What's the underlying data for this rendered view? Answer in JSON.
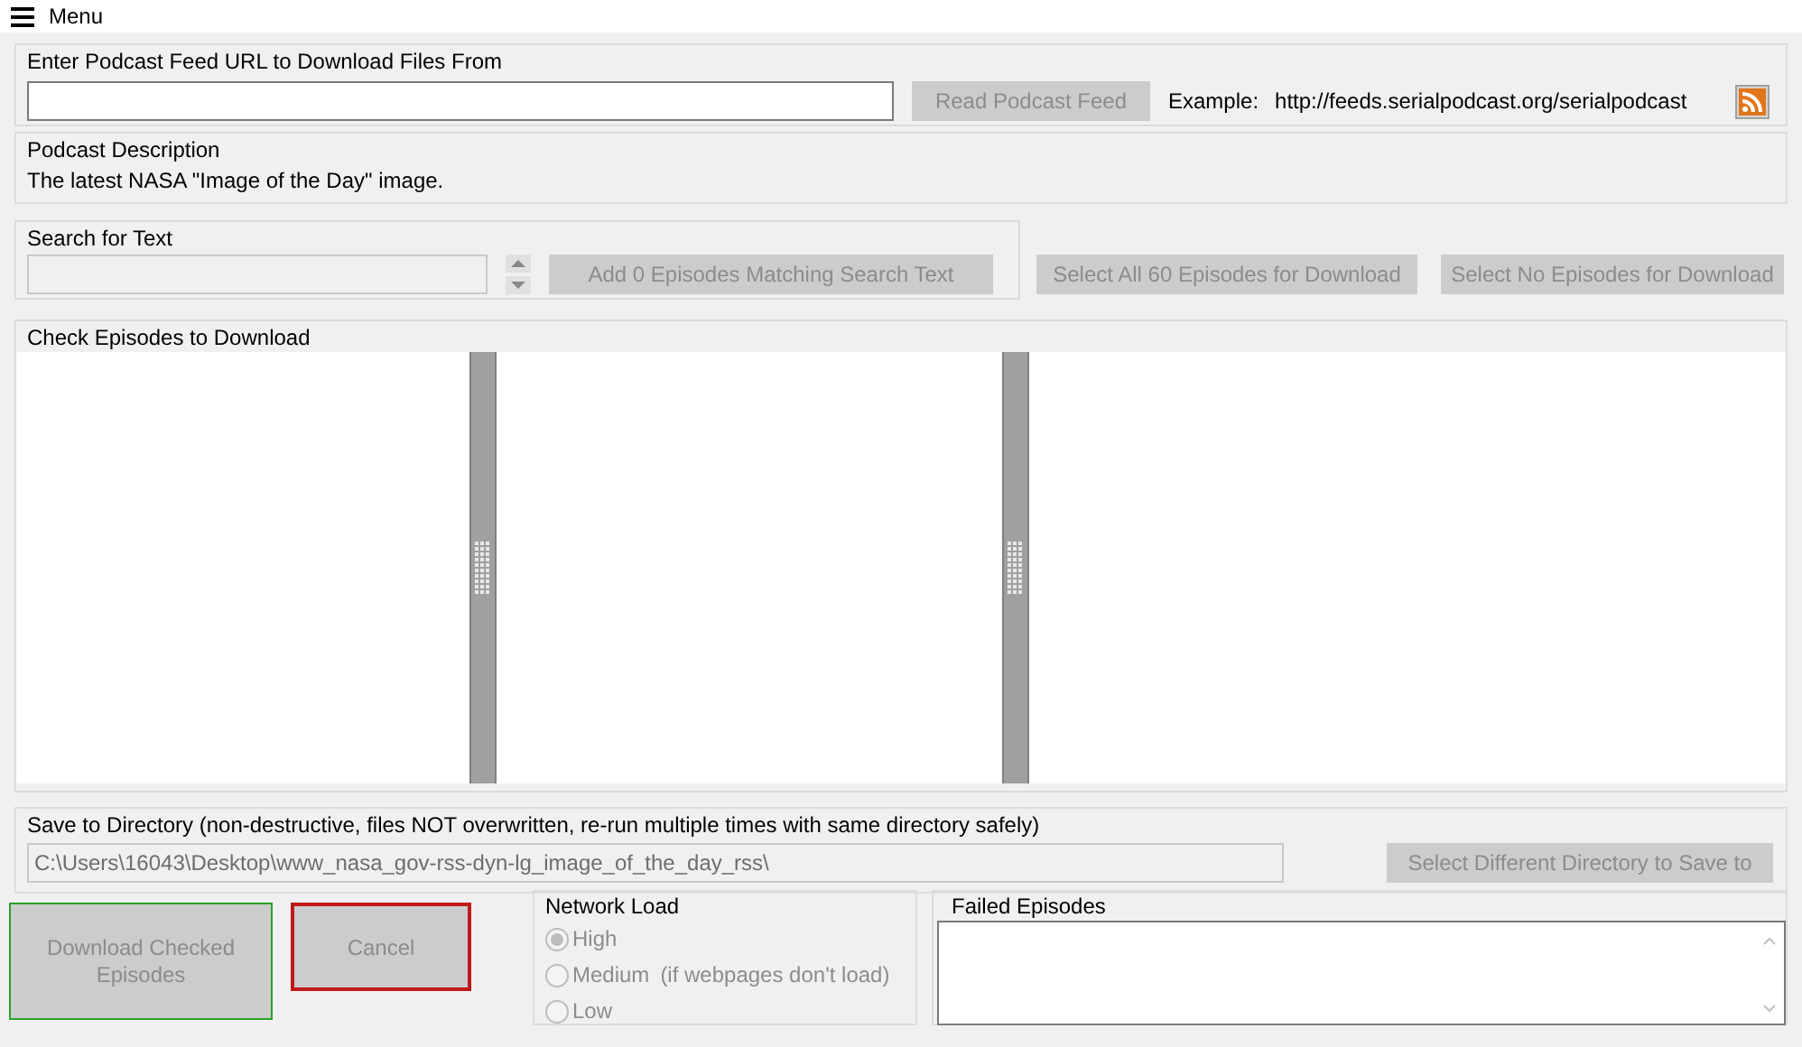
{
  "menu": {
    "label": "Menu"
  },
  "feed": {
    "legend": "Enter Podcast Feed URL to Download Files From",
    "read_button": {
      "label": "Read Podcast Feed",
      "disabled": true
    },
    "example_label": "Example:",
    "example_url": "http://feeds.serialpodcast.org/serialpodcast"
  },
  "description": {
    "legend": "Podcast Description",
    "text": "The latest NASA \"Image of the Day\" image."
  },
  "search": {
    "legend": "Search for Text",
    "disabled": true,
    "add_button": {
      "label": "Add 0 Episodes Matching Search Text",
      "disabled": true
    }
  },
  "select_all_button": {
    "label": "Select All 60 Episodes for Download",
    "disabled": true
  },
  "select_none_button": {
    "label": "Select No Episodes for Download",
    "disabled": true
  },
  "episodes": {
    "legend": "Check Episodes to Download"
  },
  "save": {
    "legend": "Save to Directory (non-destructive, files NOT overwritten, re-run multiple times with same directory safely)",
    "path": "C:\\Users\\16043\\Desktop\\www_nasa_gov-rss-dyn-lg_image_of_the_day_rss\\",
    "button": {
      "label": "Select Different Directory to Save to",
      "disabled": true
    }
  },
  "download_button": {
    "label": "Download Checked Episodes",
    "disabled": true
  },
  "cancel_button": {
    "label": "Cancel",
    "disabled": true
  },
  "network_load": {
    "legend": "Network Load",
    "options": [
      {
        "label": "High",
        "selected": true,
        "disabled": true
      },
      {
        "label": "Medium",
        "note": "(if webpages don't load)",
        "selected": false,
        "disabled": true
      },
      {
        "label": "Low",
        "selected": false,
        "disabled": true
      }
    ]
  },
  "failed": {
    "legend": "Failed Episodes"
  }
}
